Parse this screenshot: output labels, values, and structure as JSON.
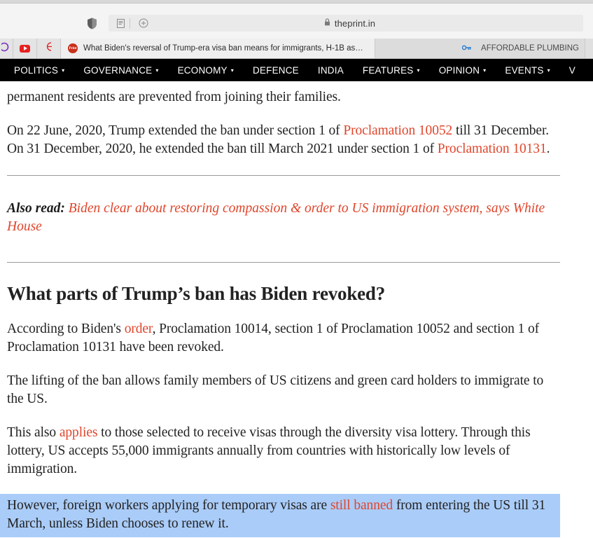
{
  "browser": {
    "url": "theprint.in",
    "lock_icon": "padlock-icon",
    "shield_icon": "shield-icon",
    "reader_icon": "reader-view-icon",
    "zoom_icon": "zoom-in-icon",
    "tabs": [
      {
        "title": "What Biden's reversal of Trump-era visa ban means for immigrants, H-1B asp…",
        "favicon": "theprint-favicon",
        "active": true
      },
      {
        "title": "AFFORDABLE PLUMBING",
        "favicon": "key-icon",
        "active": false
      }
    ],
    "pinned_tabs": [
      {
        "favicon": "purple-circle-icon"
      },
      {
        "favicon": "youtube-icon"
      },
      {
        "favicon": "red-crescent-icon"
      }
    ]
  },
  "site_nav": {
    "items": [
      {
        "label": "POLITICS",
        "has_dropdown": true
      },
      {
        "label": "GOVERNANCE",
        "has_dropdown": true
      },
      {
        "label": "ECONOMY",
        "has_dropdown": true
      },
      {
        "label": "DEFENCE",
        "has_dropdown": false
      },
      {
        "label": "INDIA",
        "has_dropdown": false
      },
      {
        "label": "FEATURES",
        "has_dropdown": true
      },
      {
        "label": "OPINION",
        "has_dropdown": true
      },
      {
        "label": "EVENTS",
        "has_dropdown": true
      },
      {
        "label": "V",
        "has_dropdown": false
      }
    ],
    "caret_glyph": "▾"
  },
  "article": {
    "para_top": {
      "text": "permanent residents are prevented from joining their families."
    },
    "para_proclamations": {
      "part1": "On 22 June, 2020, Trump extended the ban under section 1 of ",
      "link1": "Proclamation 10052",
      "part2": " till 31 December. On 31 December, 2020, he extended the ban till March 2021 under section 1 of ",
      "link2": "Proclamation 10131",
      "part3": "."
    },
    "also_read": {
      "label": "Also read:",
      "link": "Biden clear about restoring compassion & order to US immigration system, says White House"
    },
    "heading": "What parts of Trump’s ban has Biden revoked?",
    "para_order": {
      "part1": "According to Biden's ",
      "link1": "order",
      "part2": ", Proclamation 10014, section 1 of Proclamation 10052 and section 1 of Proclamation 10131 have been revoked."
    },
    "para_lifting": {
      "text": "The lifting of the ban allows family members of US citizens and green card holders to immigrate to the US."
    },
    "para_lottery": {
      "part1": "This also ",
      "link1": "applies",
      "part2": " to those selected to receive visas through the diversity visa lottery. Through this lottery, US accepts 55,000 immigrants annually from countries with historically low levels of immigration."
    },
    "para_selected": {
      "part1": "However, foreign workers applying for temporary visas are ",
      "link1": "still banned",
      "part2": " from entering the US till 31 March, unless Biden chooses to renew it."
    }
  },
  "colors": {
    "link": "#e0452b",
    "selection": "#aaccf8",
    "nav_bg": "#000000",
    "text": "#222222"
  }
}
